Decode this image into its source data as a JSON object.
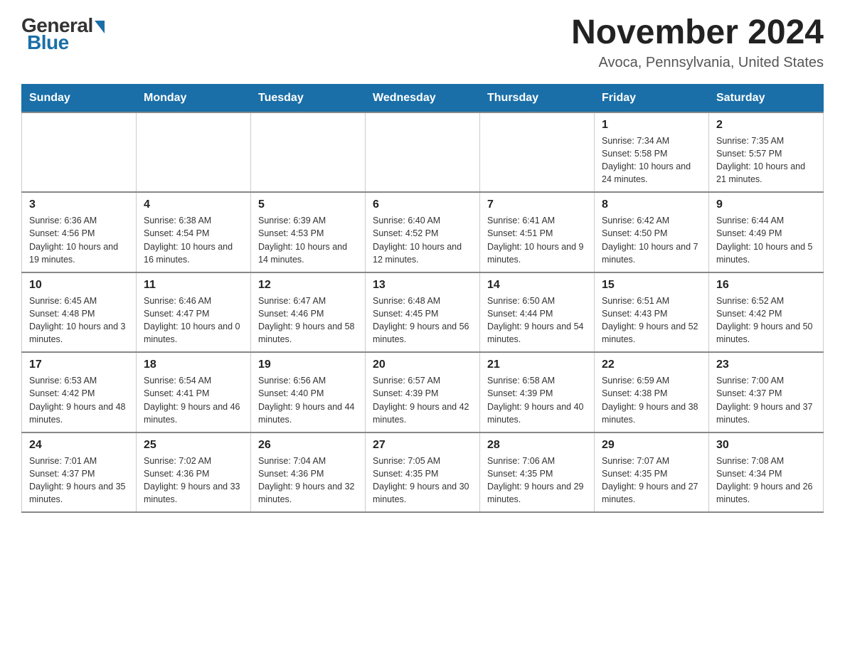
{
  "logo": {
    "general": "General",
    "blue": "Blue"
  },
  "title": "November 2024",
  "subtitle": "Avoca, Pennsylvania, United States",
  "weekdays": [
    "Sunday",
    "Monday",
    "Tuesday",
    "Wednesday",
    "Thursday",
    "Friday",
    "Saturday"
  ],
  "weeks": [
    [
      {
        "day": "",
        "info": ""
      },
      {
        "day": "",
        "info": ""
      },
      {
        "day": "",
        "info": ""
      },
      {
        "day": "",
        "info": ""
      },
      {
        "day": "",
        "info": ""
      },
      {
        "day": "1",
        "info": "Sunrise: 7:34 AM\nSunset: 5:58 PM\nDaylight: 10 hours and 24 minutes."
      },
      {
        "day": "2",
        "info": "Sunrise: 7:35 AM\nSunset: 5:57 PM\nDaylight: 10 hours and 21 minutes."
      }
    ],
    [
      {
        "day": "3",
        "info": "Sunrise: 6:36 AM\nSunset: 4:56 PM\nDaylight: 10 hours and 19 minutes."
      },
      {
        "day": "4",
        "info": "Sunrise: 6:38 AM\nSunset: 4:54 PM\nDaylight: 10 hours and 16 minutes."
      },
      {
        "day": "5",
        "info": "Sunrise: 6:39 AM\nSunset: 4:53 PM\nDaylight: 10 hours and 14 minutes."
      },
      {
        "day": "6",
        "info": "Sunrise: 6:40 AM\nSunset: 4:52 PM\nDaylight: 10 hours and 12 minutes."
      },
      {
        "day": "7",
        "info": "Sunrise: 6:41 AM\nSunset: 4:51 PM\nDaylight: 10 hours and 9 minutes."
      },
      {
        "day": "8",
        "info": "Sunrise: 6:42 AM\nSunset: 4:50 PM\nDaylight: 10 hours and 7 minutes."
      },
      {
        "day": "9",
        "info": "Sunrise: 6:44 AM\nSunset: 4:49 PM\nDaylight: 10 hours and 5 minutes."
      }
    ],
    [
      {
        "day": "10",
        "info": "Sunrise: 6:45 AM\nSunset: 4:48 PM\nDaylight: 10 hours and 3 minutes."
      },
      {
        "day": "11",
        "info": "Sunrise: 6:46 AM\nSunset: 4:47 PM\nDaylight: 10 hours and 0 minutes."
      },
      {
        "day": "12",
        "info": "Sunrise: 6:47 AM\nSunset: 4:46 PM\nDaylight: 9 hours and 58 minutes."
      },
      {
        "day": "13",
        "info": "Sunrise: 6:48 AM\nSunset: 4:45 PM\nDaylight: 9 hours and 56 minutes."
      },
      {
        "day": "14",
        "info": "Sunrise: 6:50 AM\nSunset: 4:44 PM\nDaylight: 9 hours and 54 minutes."
      },
      {
        "day": "15",
        "info": "Sunrise: 6:51 AM\nSunset: 4:43 PM\nDaylight: 9 hours and 52 minutes."
      },
      {
        "day": "16",
        "info": "Sunrise: 6:52 AM\nSunset: 4:42 PM\nDaylight: 9 hours and 50 minutes."
      }
    ],
    [
      {
        "day": "17",
        "info": "Sunrise: 6:53 AM\nSunset: 4:42 PM\nDaylight: 9 hours and 48 minutes."
      },
      {
        "day": "18",
        "info": "Sunrise: 6:54 AM\nSunset: 4:41 PM\nDaylight: 9 hours and 46 minutes."
      },
      {
        "day": "19",
        "info": "Sunrise: 6:56 AM\nSunset: 4:40 PM\nDaylight: 9 hours and 44 minutes."
      },
      {
        "day": "20",
        "info": "Sunrise: 6:57 AM\nSunset: 4:39 PM\nDaylight: 9 hours and 42 minutes."
      },
      {
        "day": "21",
        "info": "Sunrise: 6:58 AM\nSunset: 4:39 PM\nDaylight: 9 hours and 40 minutes."
      },
      {
        "day": "22",
        "info": "Sunrise: 6:59 AM\nSunset: 4:38 PM\nDaylight: 9 hours and 38 minutes."
      },
      {
        "day": "23",
        "info": "Sunrise: 7:00 AM\nSunset: 4:37 PM\nDaylight: 9 hours and 37 minutes."
      }
    ],
    [
      {
        "day": "24",
        "info": "Sunrise: 7:01 AM\nSunset: 4:37 PM\nDaylight: 9 hours and 35 minutes."
      },
      {
        "day": "25",
        "info": "Sunrise: 7:02 AM\nSunset: 4:36 PM\nDaylight: 9 hours and 33 minutes."
      },
      {
        "day": "26",
        "info": "Sunrise: 7:04 AM\nSunset: 4:36 PM\nDaylight: 9 hours and 32 minutes."
      },
      {
        "day": "27",
        "info": "Sunrise: 7:05 AM\nSunset: 4:35 PM\nDaylight: 9 hours and 30 minutes."
      },
      {
        "day": "28",
        "info": "Sunrise: 7:06 AM\nSunset: 4:35 PM\nDaylight: 9 hours and 29 minutes."
      },
      {
        "day": "29",
        "info": "Sunrise: 7:07 AM\nSunset: 4:35 PM\nDaylight: 9 hours and 27 minutes."
      },
      {
        "day": "30",
        "info": "Sunrise: 7:08 AM\nSunset: 4:34 PM\nDaylight: 9 hours and 26 minutes."
      }
    ]
  ]
}
